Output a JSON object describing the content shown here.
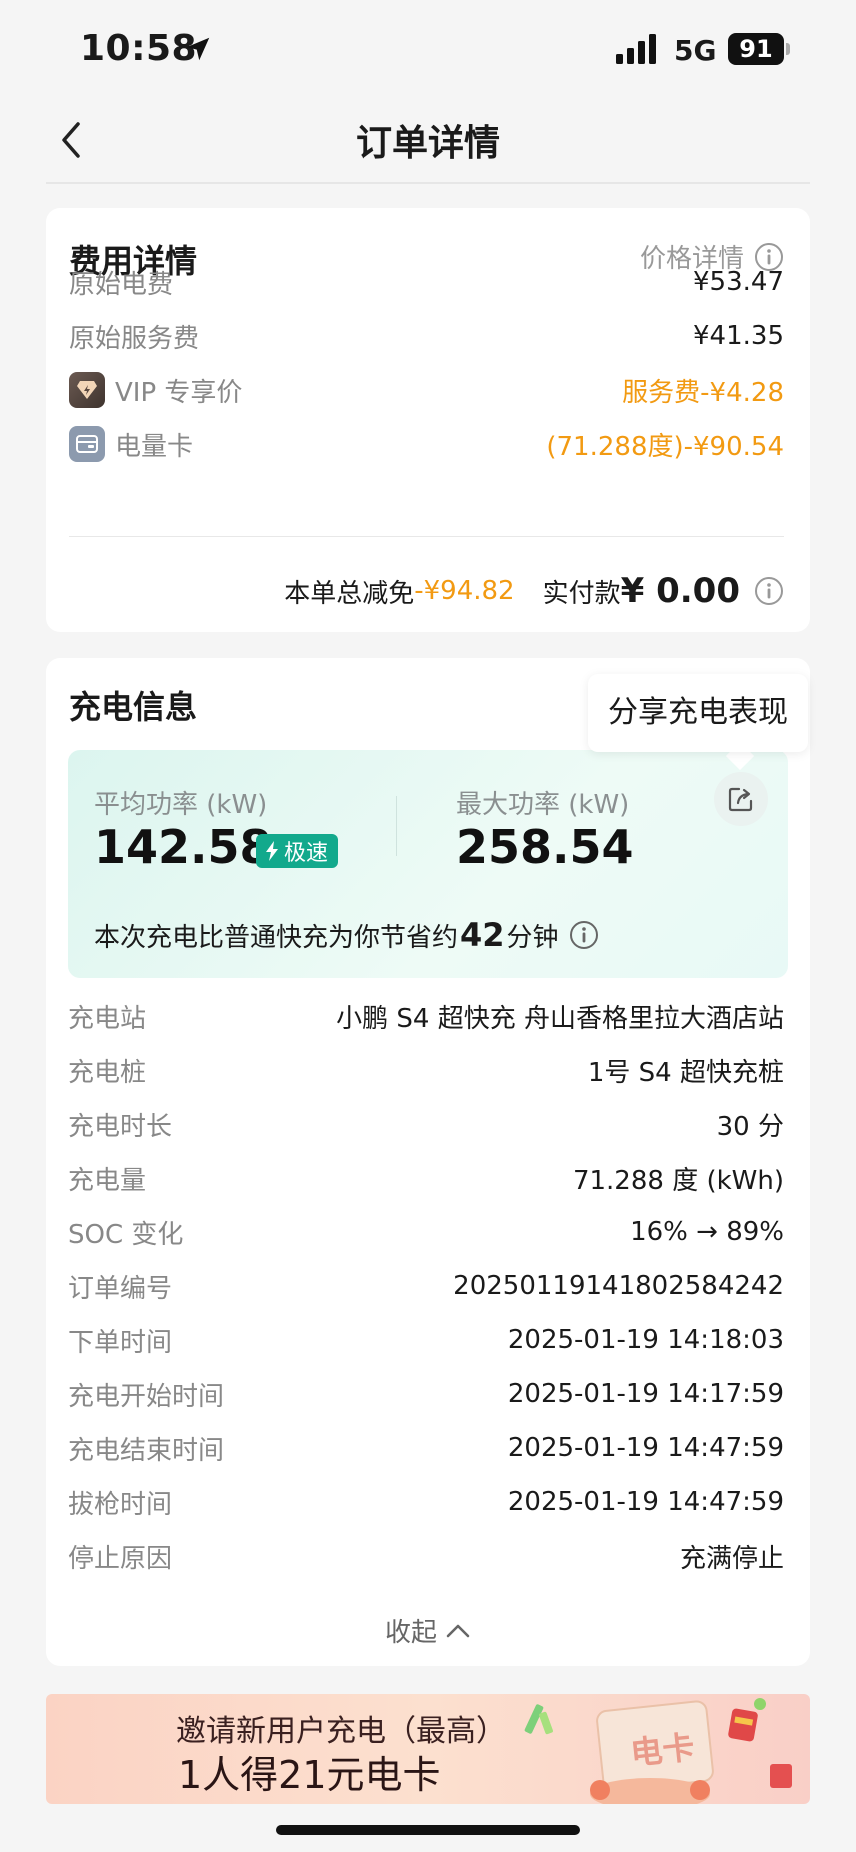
{
  "status_bar": {
    "time": "10:58",
    "network": "5G",
    "battery": "91"
  },
  "nav": {
    "title": "订单详情"
  },
  "fee": {
    "title": "费用详情",
    "price_detail": "价格详情",
    "rows": [
      {
        "label": "原始电费",
        "value": "¥53.47"
      },
      {
        "label": "原始服务费",
        "value": "¥41.35"
      },
      {
        "label": "VIP 专享价",
        "value": "服务费-¥4.28"
      },
      {
        "label": "电量卡",
        "value": "(71.288度)-¥90.54"
      }
    ],
    "total_reduce_label": "本单总减免",
    "total_reduce_value": "-¥94.82",
    "paid_label": "实付款",
    "paid_value": "¥ 0.00"
  },
  "charge": {
    "title": "充电信息",
    "tooltip": "分享充电表现",
    "avg_power_label": "平均功率 (kW)",
    "avg_power_value": "142.58",
    "speed_badge": "极速",
    "max_power_label": "最大功率 (kW)",
    "max_power_value": "258.54",
    "save_prefix": "本次充电比普通快充为你节省约",
    "save_minutes": "42",
    "save_suffix": "分钟",
    "rows": [
      {
        "label": "充电站",
        "value": "小鹏 S4 超快充 舟山香格里拉大酒店站"
      },
      {
        "label": "充电桩",
        "value": "1号 S4 超快充桩"
      },
      {
        "label": "充电时长",
        "value": "30 分"
      },
      {
        "label": "充电量",
        "value": "71.288 度 (kWh)"
      },
      {
        "label": "SOC 变化",
        "value": "16% → 89%"
      },
      {
        "label": "订单编号",
        "value": "20250119141802584242"
      },
      {
        "label": "下单时间",
        "value": "2025-01-19 14:18:03"
      },
      {
        "label": "充电开始时间",
        "value": "2025-01-19 14:17:59"
      },
      {
        "label": "充电结束时间",
        "value": "2025-01-19 14:47:59"
      },
      {
        "label": "拔枪时间",
        "value": "2025-01-19 14:47:59"
      },
      {
        "label": "停止原因",
        "value": "充满停止"
      }
    ],
    "collapse_label": "收起"
  },
  "banner": {
    "line1": "邀请新用户充电（最高）",
    "line2": "1人得21元电卡",
    "art_text": "电卡"
  },
  "colors": {
    "accent_orange": "#f29a12",
    "accent_green": "#12a98c"
  }
}
